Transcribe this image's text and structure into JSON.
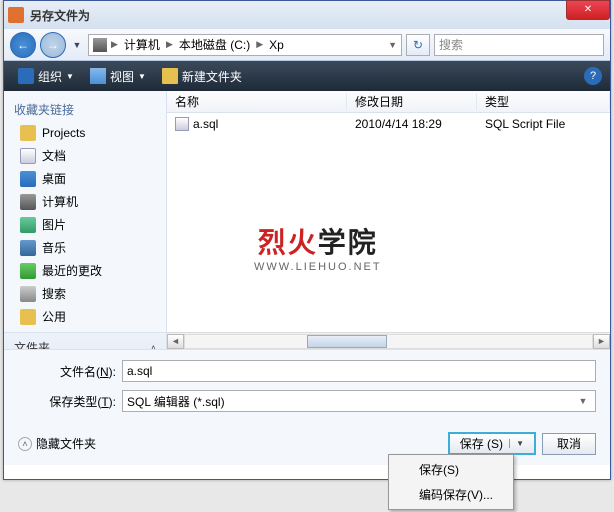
{
  "window": {
    "title": "另存文件为"
  },
  "nav": {
    "path_root": "计算机",
    "path_drive": "本地磁盘 (C:)",
    "path_folder": "Xp",
    "search_placeholder": "搜索"
  },
  "toolbar": {
    "organize": "组织",
    "view": "视图",
    "newfolder": "新建文件夹"
  },
  "sidebar": {
    "header": "收藏夹链接",
    "items": [
      {
        "label": "Projects"
      },
      {
        "label": "文档"
      },
      {
        "label": "桌面"
      },
      {
        "label": "计算机"
      },
      {
        "label": "图片"
      },
      {
        "label": "音乐"
      },
      {
        "label": "最近的更改"
      },
      {
        "label": "搜索"
      },
      {
        "label": "公用"
      }
    ],
    "folders": "文件夹"
  },
  "filelist": {
    "cols": {
      "name": "名称",
      "date": "修改日期",
      "type": "类型"
    },
    "rows": [
      {
        "name": "a.sql",
        "date": "2010/4/14 18:29",
        "type": "SQL Script File"
      }
    ]
  },
  "form": {
    "filename_label_pre": "文件名(",
    "filename_label_key": "N",
    "filename_label_post": "):",
    "filename_value": "a.sql",
    "filetype_label_pre": "保存类型(",
    "filetype_label_key": "T",
    "filetype_label_post": "):",
    "filetype_value": "SQL 编辑器 (*.sql)"
  },
  "footer": {
    "hide": "隐藏文件夹",
    "save": "保存 (S)",
    "cancel": "取消",
    "menu": {
      "save": "保存(S)",
      "encode_save": "编码保存(V)..."
    }
  },
  "watermark": {
    "cn1": "烈火",
    "cn2": "学院",
    "url": "WWW.LIEHUO.NET"
  }
}
